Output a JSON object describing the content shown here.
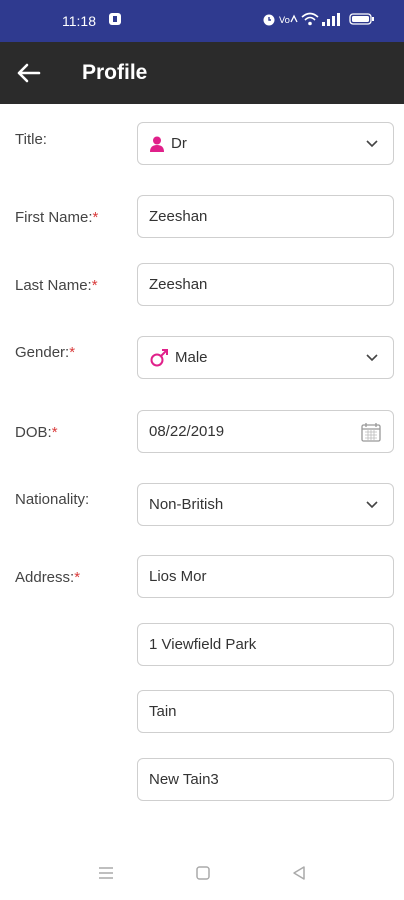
{
  "status_bar": {
    "time": "11:18",
    "icons": [
      "app-notification-icon",
      "alarm-icon",
      "vowifi-icon",
      "wifi-icon",
      "signal-icon",
      "battery-icon"
    ]
  },
  "app_bar": {
    "title": "Profile",
    "back_icon": "arrow-left-icon"
  },
  "form": {
    "title": {
      "label": "Title:",
      "value": "Dr",
      "icon": "person-icon"
    },
    "first_name": {
      "label": "First Name:",
      "required_mark": "*",
      "value": "Zeeshan"
    },
    "last_name": {
      "label": "Last Name:",
      "required_mark": "*",
      "value": "Zeeshan"
    },
    "gender": {
      "label": "Gender:",
      "required_mark": "*",
      "value": "Male",
      "icon": "male-symbol-icon"
    },
    "dob": {
      "label": "DOB:",
      "required_mark": "*",
      "value": "08/22/2019",
      "icon": "calendar-icon"
    },
    "nationality": {
      "label": "Nationality:",
      "value": "Non-British"
    },
    "address": {
      "label": "Address:",
      "required_mark": "*",
      "lines": [
        "Lios Mor",
        "1 Viewfield Park",
        "Tain",
        "New Tain3"
      ]
    }
  },
  "colors": {
    "status_bar": "#2f3a8f",
    "app_bar": "#2b2b2b",
    "accent_pink": "#e0208a",
    "required": "#d93a3a"
  },
  "nav_bar": {
    "icons": [
      "menu-icon",
      "home-square-icon",
      "back-triangle-icon"
    ]
  }
}
